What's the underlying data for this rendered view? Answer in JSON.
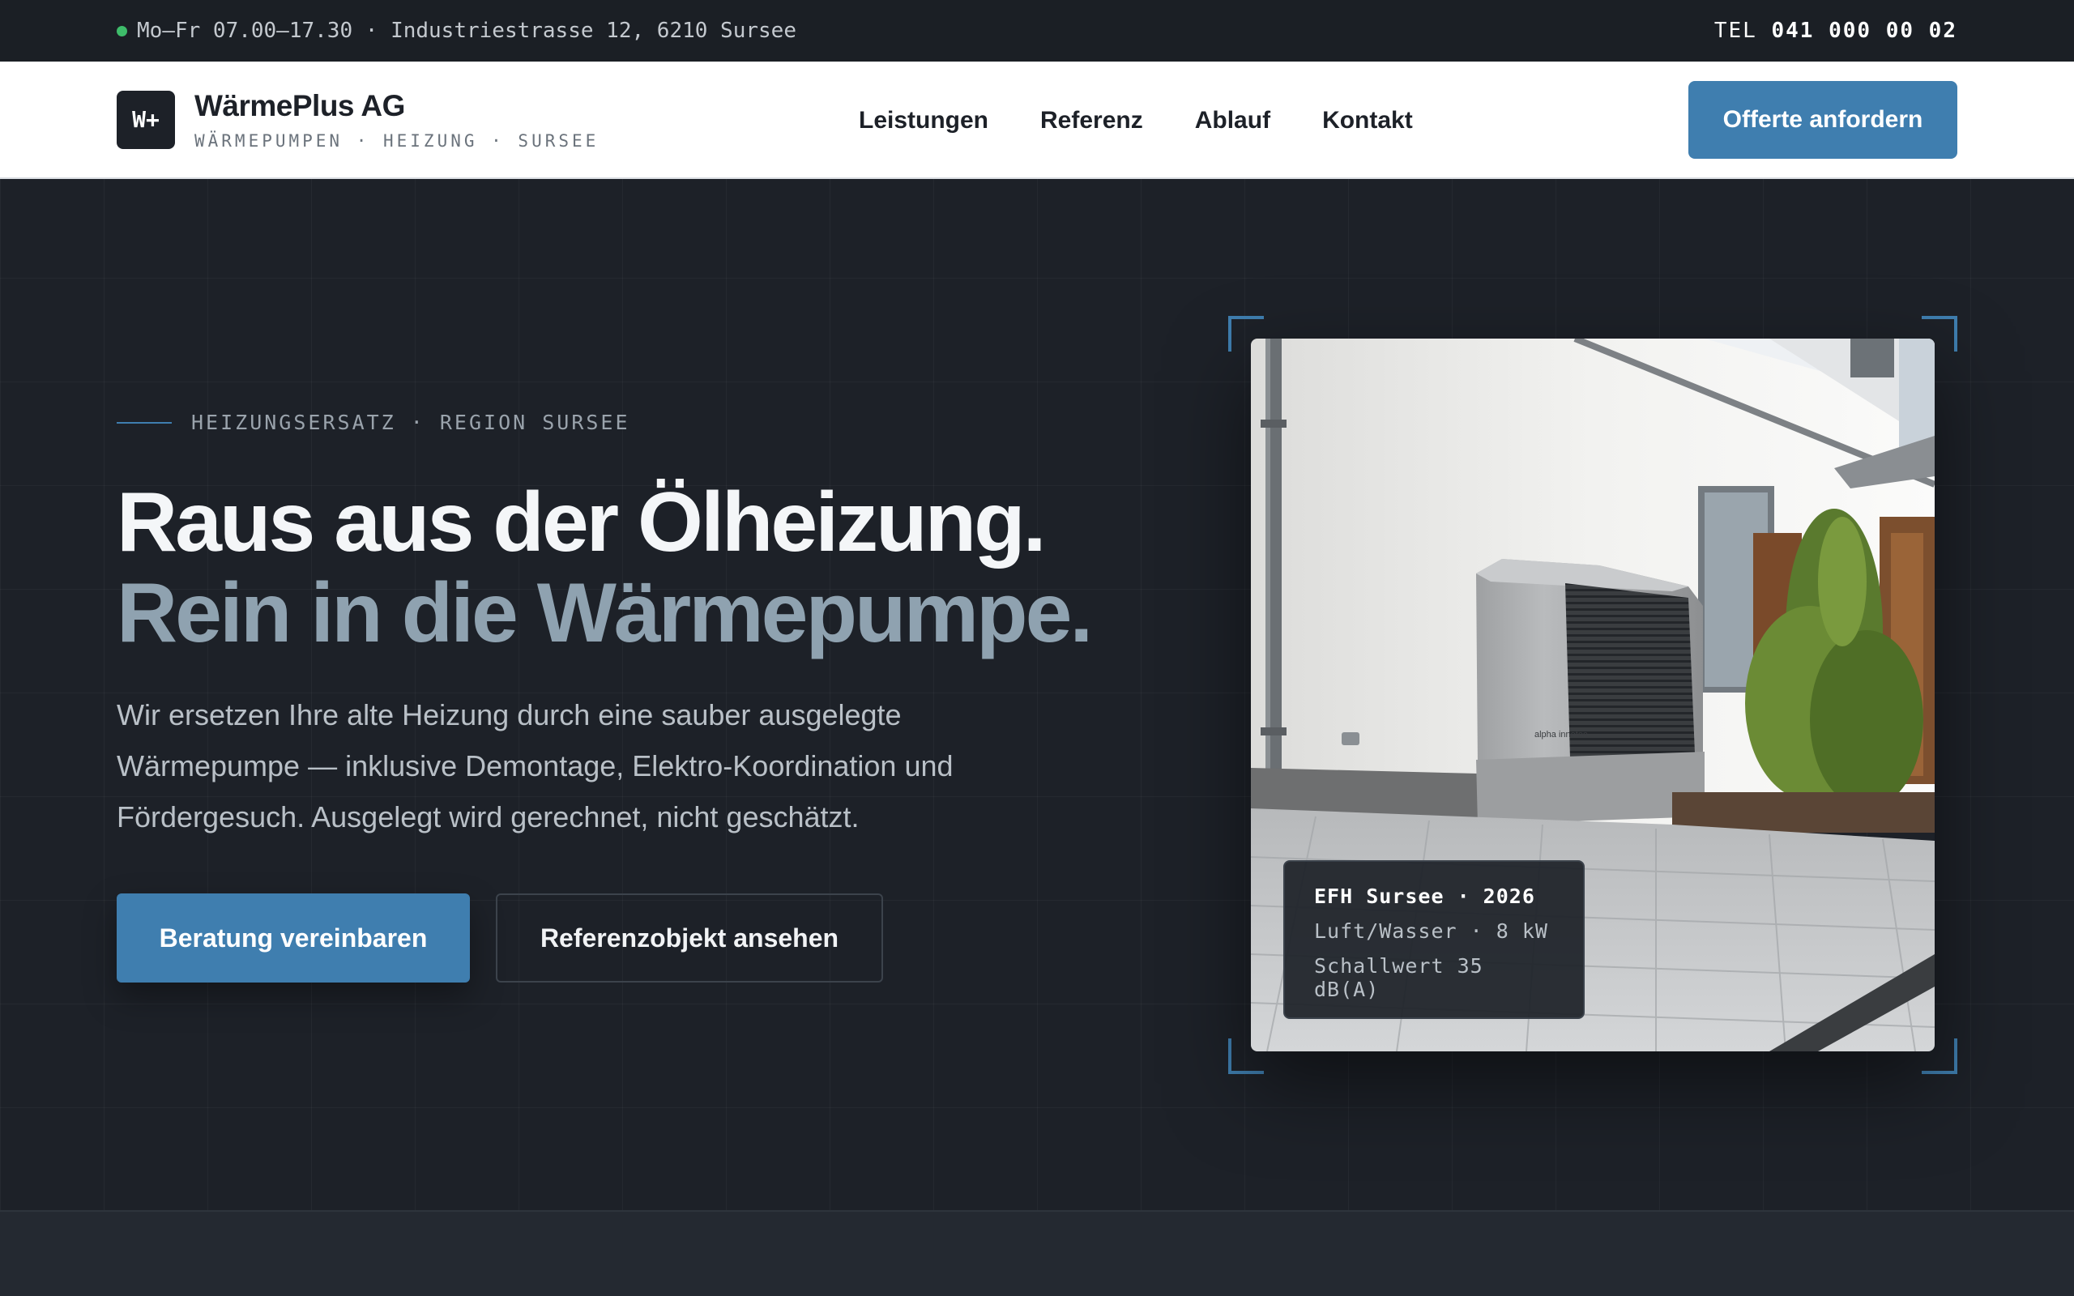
{
  "topbar": {
    "hours_address": "Mo–Fr 07.00–17.30 · Industriestrasse 12, 6210 Sursee",
    "phone_label": "TEL",
    "phone_number": "041 000 00 02"
  },
  "nav": {
    "logo_mark": "W+",
    "brand_name": "WärmePlus AG",
    "brand_tagline": "WÄRMEPUMPEN · HEIZUNG · SURSEE",
    "links": [
      "Leistungen",
      "Referenz",
      "Ablauf",
      "Kontakt"
    ],
    "cta": "Offerte anfordern"
  },
  "hero": {
    "eyebrow": "HEIZUNGSERSATZ · REGION SURSEE",
    "headline_line1": "Raus aus der Ölheizung.",
    "headline_line2": "Rein in die Wärmepumpe.",
    "lead": "Wir ersetzen Ihre alte Heizung durch eine sauber ausgelegte Wärmepumpe — inklusive Demontage, Elektro-Koordination und Fördergesuch. Ausgelegt wird gerechnet, nicht geschätzt.",
    "primary_button": "Beratung vereinbaren",
    "secondary_button": "Referenzobjekt ansehen"
  },
  "photo_caption": {
    "title": "EFH Sursee · 2026",
    "line2": "Luft/Wasser · 8 kW",
    "line3": "Schallwert 35 dB(A)",
    "unit_brand": "alpha innotec"
  },
  "colors": {
    "accent": "#3f7eaf",
    "dark_bg": "#1d2128",
    "status_dot": "#3ebc6a"
  }
}
